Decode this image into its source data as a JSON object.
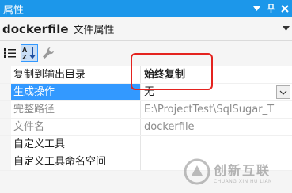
{
  "titlebar": {
    "title": "属性",
    "dropdown_icon": "chevron-down-icon",
    "pin_icon": "pin-icon",
    "close_icon": "close-icon"
  },
  "object": {
    "name": "dockerfile",
    "type": "文件属性"
  },
  "toolbar": {
    "categorized_icon": "categorized-icon",
    "alphabetical_icon": "alphabetical-sort-icon",
    "property_pages_icon": "wrench-icon"
  },
  "properties": [
    {
      "name": "复制到输出目录",
      "value": "始终复制"
    },
    {
      "name": "生成操作",
      "value": "无"
    },
    {
      "name": "完整路径",
      "value": "E:\\ProjectTest\\SqlSugar_T"
    },
    {
      "name": "文件名",
      "value": "dockerfile"
    },
    {
      "name": "自定义工具",
      "value": ""
    },
    {
      "name": "自定义工具命名空间",
      "value": ""
    }
  ],
  "watermark": {
    "cn": "创新互联",
    "en": "CHUANG XIN HU LIAN"
  },
  "colors": {
    "titlebar": "#1c97ea",
    "selection": "#3399ff",
    "highlight": "#e4231f"
  }
}
